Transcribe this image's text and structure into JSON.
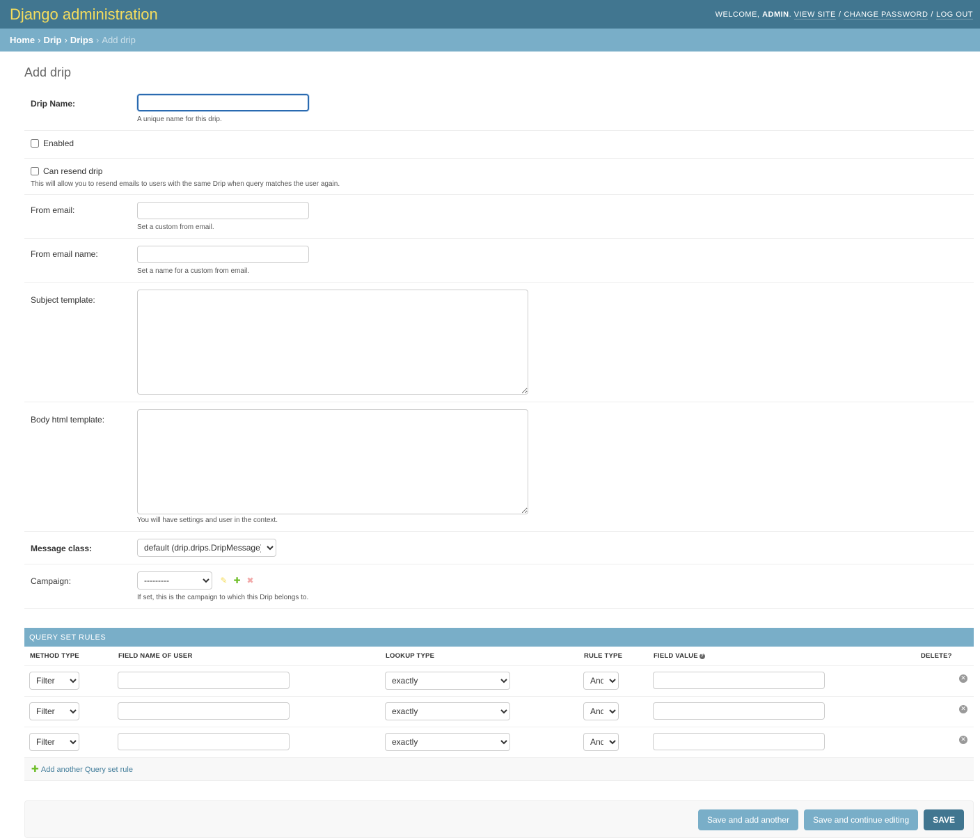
{
  "header": {
    "branding": "Django administration",
    "welcome": "Welcome,",
    "username": "admin",
    "view_site": "View site",
    "change_password": "Change password",
    "log_out": "Log out"
  },
  "breadcrumbs": {
    "home": "Home",
    "app": "Drip",
    "model": "Drips",
    "current": "Add drip",
    "sep": "›"
  },
  "page": {
    "title": "Add drip"
  },
  "form": {
    "drip_name": {
      "label": "Drip Name:",
      "value": "",
      "help": "A unique name for this drip."
    },
    "enabled": {
      "label": "Enabled",
      "checked": false
    },
    "can_resend": {
      "label": "Can resend drip",
      "checked": false,
      "help": "This will allow you to resend emails to users with the same Drip when query matches the user again."
    },
    "from_email": {
      "label": "From email:",
      "value": "",
      "help": "Set a custom from email."
    },
    "from_email_name": {
      "label": "From email name:",
      "value": "",
      "help": "Set a name for a custom from email."
    },
    "subject_template": {
      "label": "Subject template:",
      "value": ""
    },
    "body_html_template": {
      "label": "Body html template:",
      "value": "",
      "help": "You will have settings and user in the context."
    },
    "message_class": {
      "label": "Message class:",
      "selected": "default (drip.drips.DripMessage)"
    },
    "campaign": {
      "label": "Campaign:",
      "selected": "---------",
      "help": "If set, this is the campaign to which this Drip belongs to."
    }
  },
  "inline": {
    "title": "Query set rules",
    "columns": {
      "method_type": "Method type",
      "field_name": "Field name of user",
      "lookup_type": "Lookup type",
      "rule_type": "Rule type",
      "field_value": "Field value",
      "delete": "Delete?"
    },
    "rows": [
      {
        "method": "Filter",
        "field_name": "",
        "lookup": "exactly",
        "rule": "And",
        "value": ""
      },
      {
        "method": "Filter",
        "field_name": "",
        "lookup": "exactly",
        "rule": "And",
        "value": ""
      },
      {
        "method": "Filter",
        "field_name": "",
        "lookup": "exactly",
        "rule": "And",
        "value": ""
      }
    ],
    "add_label": "Add another Query set rule"
  },
  "submit": {
    "save_add_another": "Save and add another",
    "save_continue": "Save and continue editing",
    "save": "SAVE"
  },
  "colors": {
    "header_bg": "#417690",
    "branding": "#f5dd5d",
    "breadcrumb_bg": "#79aec8",
    "button": "#79aec8",
    "button_default": "#417690"
  }
}
